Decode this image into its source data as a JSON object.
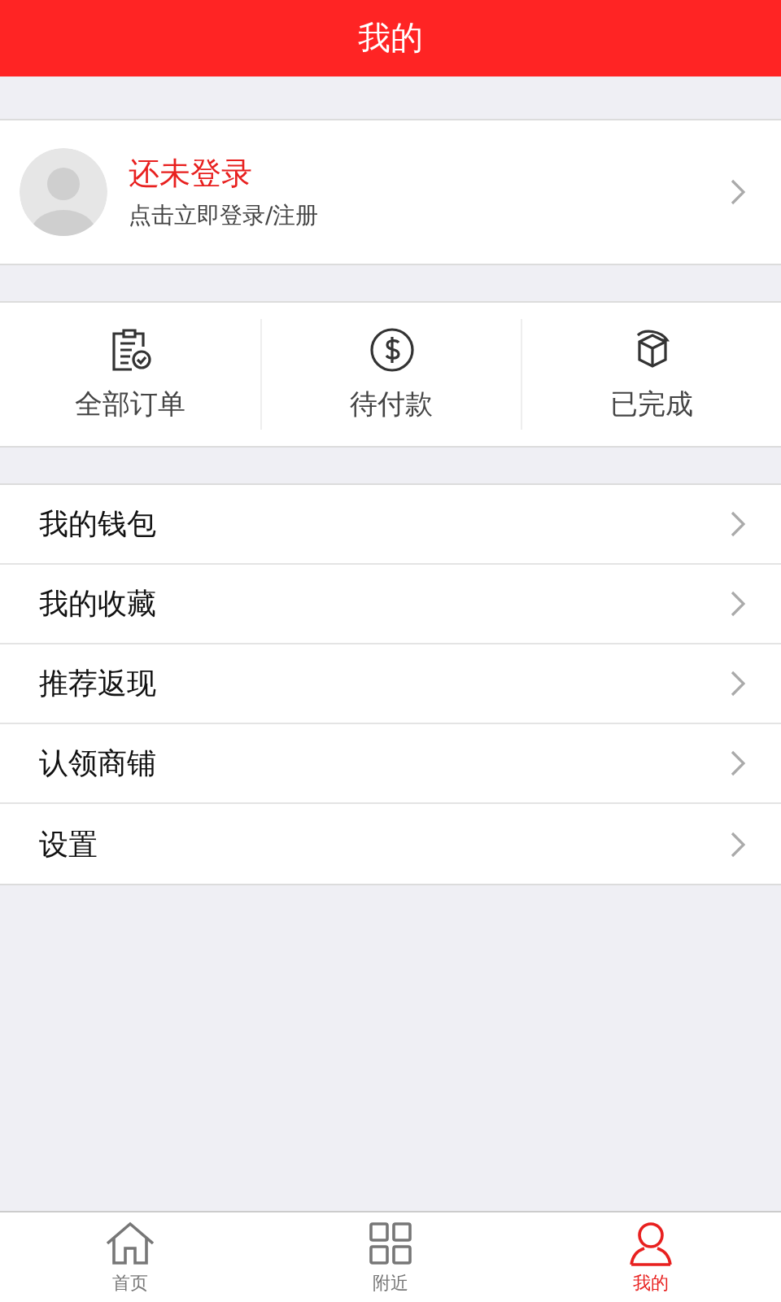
{
  "header": {
    "title": "我的"
  },
  "profile": {
    "name": "还未登录",
    "hint": "点击立即登录/注册"
  },
  "orders": [
    {
      "kind": "all",
      "label": "全部订单"
    },
    {
      "kind": "unpaid",
      "label": "待付款"
    },
    {
      "kind": "done",
      "label": "已完成"
    }
  ],
  "menu": [
    {
      "label": "我的钱包"
    },
    {
      "label": "我的收藏"
    },
    {
      "label": "推荐返现"
    },
    {
      "label": "认领商铺"
    },
    {
      "label": "设置"
    }
  ],
  "tabbar": [
    {
      "kind": "home",
      "label": "首页",
      "selected": false
    },
    {
      "kind": "nearby",
      "label": "附近",
      "selected": false
    },
    {
      "kind": "me",
      "label": "我的",
      "selected": true
    }
  ]
}
